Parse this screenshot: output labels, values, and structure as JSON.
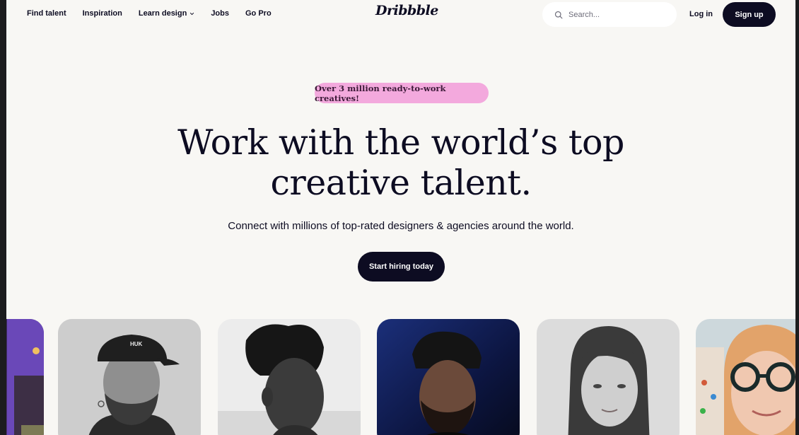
{
  "nav": {
    "links": [
      "Find talent",
      "Inspiration",
      "Learn design",
      "Jobs",
      "Go Pro"
    ],
    "logo": "Dribbble",
    "search_placeholder": "Search...",
    "login_label": "Log in",
    "signup_label": "Sign up"
  },
  "hero": {
    "badge": "Over 3 million ready-to-work creatives!",
    "headline_line1": "Work with the world’s top",
    "headline_line2": "creative talent.",
    "subtitle": "Connect with millions of top-rated designers & agencies around the world.",
    "cta_label": "Start hiring today"
  },
  "cards": {
    "count": 6,
    "card_1_hat_text": "HUK"
  },
  "colors": {
    "background": "#f8f7f4",
    "primary_dark": "#0d0c22",
    "badge_pink": "#f3a9dd"
  }
}
